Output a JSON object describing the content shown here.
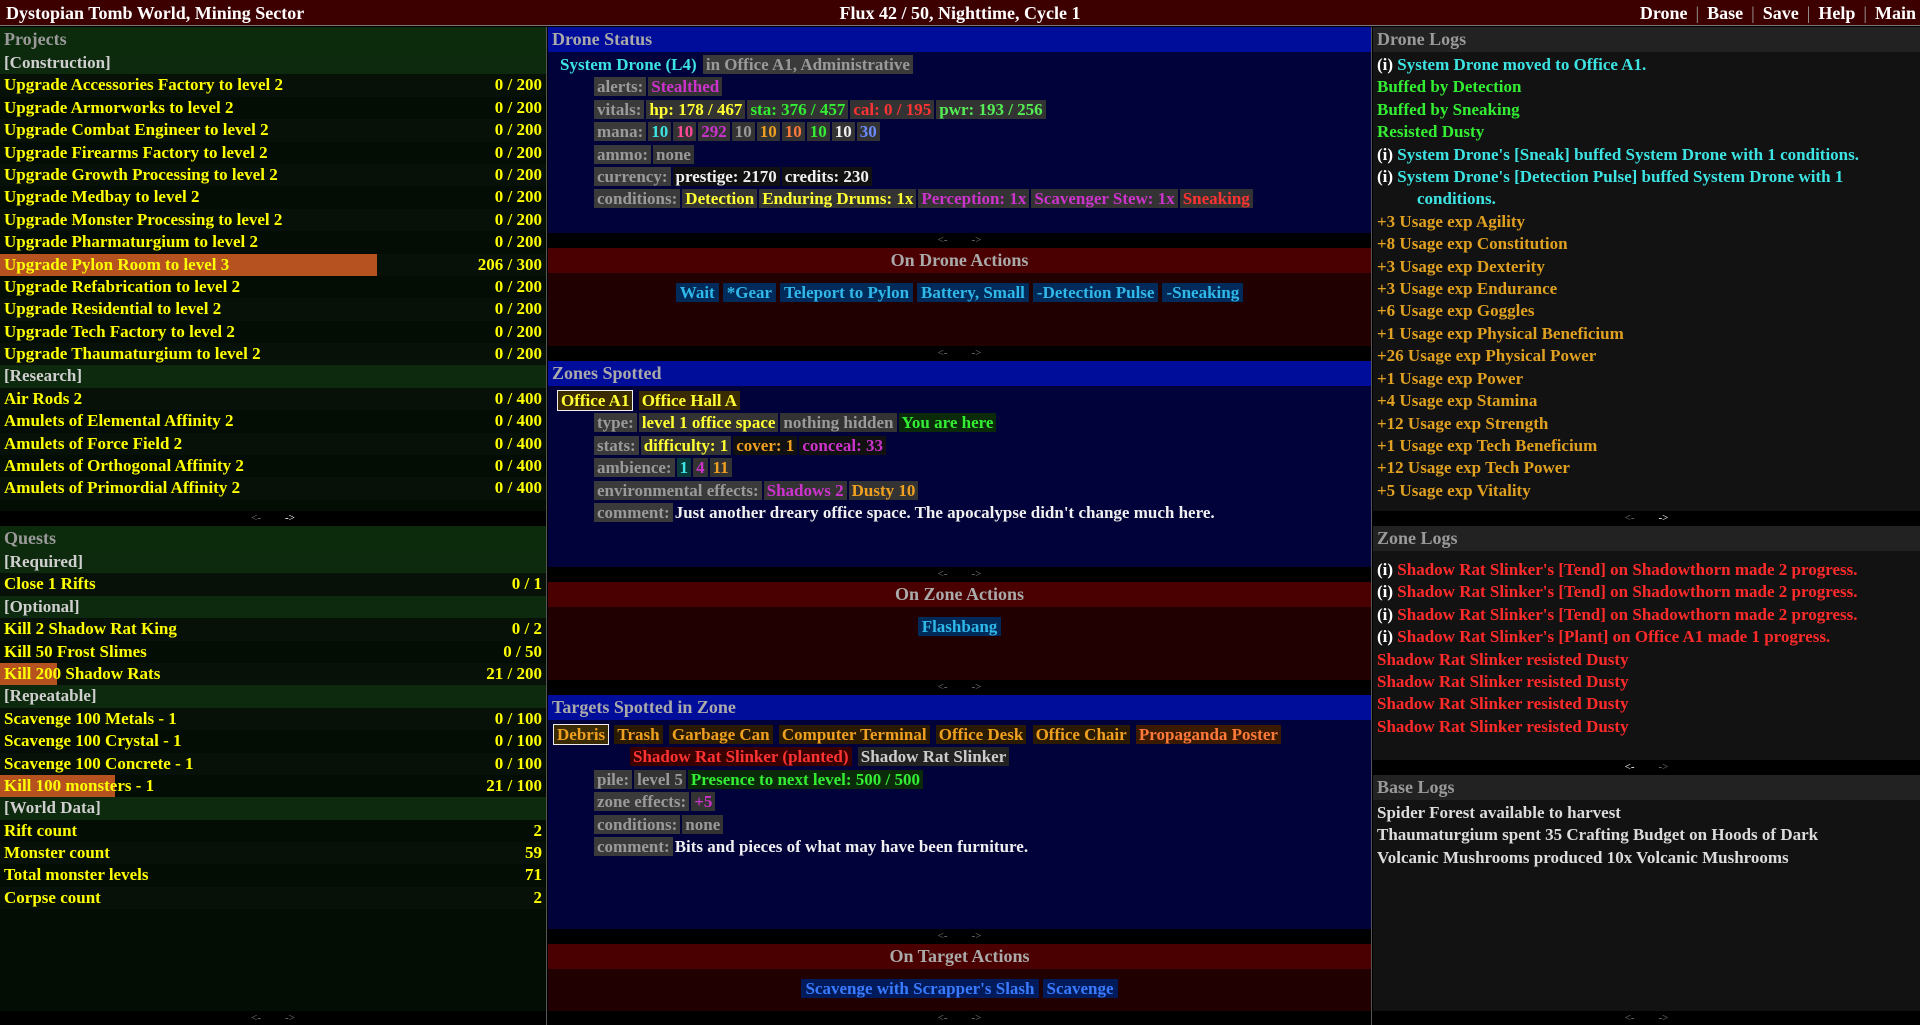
{
  "topbar": {
    "left": "Dystopian Tomb World, Mining Sector",
    "center": "Flux 42 / 50, Nighttime, Cycle 1",
    "menu": [
      "Drone",
      "Base",
      "Save",
      "Help",
      "Main"
    ]
  },
  "pager": {
    "prev": "<-",
    "next": "->"
  },
  "projects": {
    "title": "Projects",
    "rows": [
      {
        "label": "[Construction]",
        "cat": true
      },
      {
        "label": "Upgrade Accessories Factory to level 2",
        "value": "0 / 200"
      },
      {
        "label": "Upgrade Armorworks to level 2",
        "value": "0 / 200"
      },
      {
        "label": "Upgrade Combat Engineer to level 2",
        "value": "0 / 200"
      },
      {
        "label": "Upgrade Firearms Factory to level 2",
        "value": "0 / 200"
      },
      {
        "label": "Upgrade Growth Processing to level 2",
        "value": "0 / 200"
      },
      {
        "label": "Upgrade Medbay to level 2",
        "value": "0 / 200"
      },
      {
        "label": "Upgrade Monster Processing to level 2",
        "value": "0 / 200"
      },
      {
        "label": "Upgrade Pharmaturgium to level 2",
        "value": "0 / 200"
      },
      {
        "label": "Upgrade Pylon Room to level 3",
        "value": "206 / 300",
        "progress": 0.69
      },
      {
        "label": "Upgrade Refabrication to level 2",
        "value": "0 / 200"
      },
      {
        "label": "Upgrade Residential to level 2",
        "value": "0 / 200"
      },
      {
        "label": "Upgrade Tech Factory to level 2",
        "value": "0 / 200"
      },
      {
        "label": "Upgrade Thaumaturgium to level 2",
        "value": "0 / 200"
      },
      {
        "label": "[Research]",
        "cat": true
      },
      {
        "label": "Air Rods 2",
        "value": "0 / 400"
      },
      {
        "label": "Amulets of Elemental Affinity 2",
        "value": "0 / 400"
      },
      {
        "label": "Amulets of Force Field 2",
        "value": "0 / 400"
      },
      {
        "label": "Amulets of Orthogonal Affinity 2",
        "value": "0 / 400"
      },
      {
        "label": "Amulets of Primordial Affinity 2",
        "value": "0 / 400"
      }
    ]
  },
  "quests": {
    "title": "Quests",
    "rows": [
      {
        "label": "[Required]",
        "cat": true
      },
      {
        "label": "Close 1 Rifts",
        "value": "0 / 1"
      },
      {
        "label": "[Optional]",
        "cat": true
      },
      {
        "label": "Kill 2 Shadow Rat King",
        "value": "0 / 2"
      },
      {
        "label": "Kill 50 Frost Slimes",
        "value": "0 / 50"
      },
      {
        "label": "Kill 200 Shadow Rats",
        "value": "21 / 200",
        "progress": 0.105
      },
      {
        "label": "[Repeatable]",
        "cat": true
      },
      {
        "label": "Scavenge 100 Metals - 1",
        "value": "0 / 100"
      },
      {
        "label": "Scavenge 100 Crystal - 1",
        "value": "0 / 100"
      },
      {
        "label": "Scavenge 100 Concrete - 1",
        "value": "0 / 100"
      },
      {
        "label": "Kill 100 monsters - 1",
        "value": "21 / 100",
        "progress": 0.21
      },
      {
        "label": "[World Data]",
        "cat": true
      },
      {
        "label": "Rift count",
        "value": "2"
      },
      {
        "label": "Monster count",
        "value": "59"
      },
      {
        "label": "Total monster levels",
        "value": "71"
      },
      {
        "label": "Corpse count",
        "value": "2"
      }
    ]
  },
  "drone": {
    "title": "Drone Status",
    "name": "System Drone (L4)",
    "location": "in Office A1, Administrative",
    "alerts_label": "alerts:",
    "alerts": "Stealthed",
    "vitals_label": "vitals:",
    "hp": "hp: 178 / 467",
    "sta": "sta: 376 / 457",
    "cal": "cal: 0 / 195",
    "pwr": "pwr: 193 / 256",
    "mana_label": "mana:",
    "mana": [
      "10",
      "10",
      "292",
      "10",
      "10",
      "10",
      "10",
      "10",
      "30"
    ],
    "ammo_label": "ammo:",
    "ammo": "none",
    "currency_label": "currency:",
    "prestige": "prestige: 2170",
    "credits": "credits: 230",
    "conditions_label": "conditions:",
    "conditions": [
      "Detection",
      "Enduring Drums: 1x",
      "Perception: 1x",
      "Scavenger Stew: 1x",
      "Sneaking"
    ]
  },
  "drone_actions": {
    "title": "On Drone Actions",
    "items": [
      "Wait",
      "*Gear",
      "Teleport to Pylon",
      "Battery, Small",
      "-Detection Pulse",
      "-Sneaking"
    ]
  },
  "zones": {
    "title": "Zones Spotted",
    "tabs": [
      "Office A1",
      "Office Hall A"
    ],
    "type_label": "type:",
    "type": [
      "level 1 office space",
      "nothing hidden",
      "You are here"
    ],
    "stats_label": "stats:",
    "difficulty": "difficulty: 1",
    "cover": "cover: 1",
    "conceal": "conceal: 33",
    "ambience_label": "ambience:",
    "ambience": [
      "1",
      "4",
      "11"
    ],
    "env_label": "environmental effects:",
    "env": [
      "Shadows 2",
      "Dusty 10"
    ],
    "comment_label": "comment:",
    "comment": "Just another dreary office space. The apocalypse didn't change much here."
  },
  "zone_actions": {
    "title": "On Zone Actions",
    "items": [
      "Flashbang"
    ]
  },
  "targets": {
    "title": "Targets Spotted in Zone",
    "items": [
      "Debris",
      "Trash",
      "Garbage Can",
      "Computer Terminal",
      "Office Desk",
      "Office Chair",
      "Propaganda Poster"
    ],
    "items2": [
      "Shadow Rat Slinker (planted)",
      "Shadow Rat Slinker"
    ],
    "pile_label": "pile:",
    "pile_level": "level 5",
    "pile_presence": "Presence to next level: 500 / 500",
    "zone_effects_label": "zone effects:",
    "zone_effects": "+5",
    "conditions_label": "conditions:",
    "conditions": "none",
    "comment_label": "comment:",
    "comment": "Bits and pieces of what may have been furniture."
  },
  "target_actions": {
    "title": "On Target Actions",
    "items": [
      "Scavenge with Scrapper's Slash",
      "Scavenge"
    ]
  },
  "drone_logs": {
    "title": "Drone Logs",
    "lines": [
      {
        "i": true,
        "text": "System Drone moved to Office A1.",
        "color": "#3de4e4"
      },
      {
        "text": "Buffed by Detection",
        "color": "#33ee33"
      },
      {
        "text": "Buffed by Sneaking",
        "color": "#33ee33"
      },
      {
        "text": "Resisted Dusty",
        "color": "#33ee33"
      },
      {
        "i": true,
        "text": "System Drone's [Sneak] buffed System Drone with 1 conditions.",
        "color": "#3de4e4"
      },
      {
        "i": true,
        "text": "System Drone's [Detection Pulse] buffed System Drone with 1",
        "cont": "conditions.",
        "color": "#3de4e4"
      },
      {
        "text": "+3 Usage exp Agility",
        "color": "#e0a020"
      },
      {
        "text": "+8 Usage exp Constitution",
        "color": "#e0a020"
      },
      {
        "text": "+3 Usage exp Dexterity",
        "color": "#e0a020"
      },
      {
        "text": "+3 Usage exp Endurance",
        "color": "#e0a020"
      },
      {
        "text": "+6 Usage exp Goggles",
        "color": "#e0a020"
      },
      {
        "text": "+1 Usage exp Physical Beneficium",
        "color": "#e0a020"
      },
      {
        "text": "+26 Usage exp Physical Power",
        "color": "#e0a020"
      },
      {
        "text": "+1 Usage exp Power",
        "color": "#e0a020"
      },
      {
        "text": "+4 Usage exp Stamina",
        "color": "#e0a020"
      },
      {
        "text": "+12 Usage exp Strength",
        "color": "#e0a020"
      },
      {
        "text": "+1 Usage exp Tech Beneficium",
        "color": "#e0a020"
      },
      {
        "text": "+12 Usage exp Tech Power",
        "color": "#e0a020"
      },
      {
        "text": "+5 Usage exp Vitality",
        "color": "#e0a020"
      }
    ]
  },
  "zone_logs": {
    "title": "Zone Logs",
    "lines": [
      {
        "i": true,
        "text": "Shadow Rat Slinker's [Tend] on Shadowthorn made 2 progress."
      },
      {
        "i": true,
        "text": "Shadow Rat Slinker's [Tend] on Shadowthorn made 2 progress."
      },
      {
        "i": true,
        "text": "Shadow Rat Slinker's [Tend] on Shadowthorn made 2 progress."
      },
      {
        "i": true,
        "text": "Shadow Rat Slinker's [Plant] on Office A1 made 1 progress."
      },
      {
        "text": "Shadow Rat Slinker resisted Dusty"
      },
      {
        "text": "Shadow Rat Slinker resisted Dusty"
      },
      {
        "text": "Shadow Rat Slinker resisted Dusty"
      },
      {
        "text": "Shadow Rat Slinker resisted Dusty"
      }
    ]
  },
  "base_logs": {
    "title": "Base Logs",
    "lines": [
      "Spider Forest available to harvest",
      "Thaumaturgium spent 35 Crafting Budget on Hoods of Dark",
      "Volcanic Mushrooms produced 10x Volcanic Mushrooms"
    ]
  }
}
